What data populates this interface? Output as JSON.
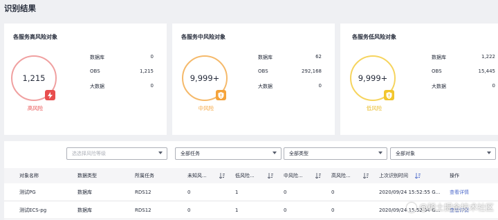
{
  "page": {
    "title": "识别结果"
  },
  "colors": {
    "high": "#e84e4e",
    "high_ring": "#f0a0a0",
    "medium": "#f5a33a",
    "medium_ring": "#f5b96a",
    "low": "#f2c62d",
    "low_ring": "#f6d45e",
    "link": "#526ecc"
  },
  "cards": [
    {
      "title": "各服务高风险对象",
      "count": "1,215",
      "level_label": "高风险",
      "badge_icon": "lightning-icon",
      "stats": [
        {
          "label": "数据库",
          "value": "0"
        },
        {
          "label": "OBS",
          "value": "1,215"
        },
        {
          "label": "大数据",
          "value": "0"
        }
      ]
    },
    {
      "title": "各服务中风险对象",
      "count": "9,999+",
      "level_label": "中风险",
      "badge_icon": "shield-icon",
      "stats": [
        {
          "label": "数据库",
          "value": "62"
        },
        {
          "label": "OBS",
          "value": "292,168"
        },
        {
          "label": "大数据",
          "value": "0"
        }
      ]
    },
    {
      "title": "各服务低风险对象",
      "count": "9,999+",
      "level_label": "低风险",
      "badge_icon": "shield-icon",
      "stats": [
        {
          "label": "数据库",
          "value": "1,222"
        },
        {
          "label": "OBS",
          "value": "15,445"
        },
        {
          "label": "大数据",
          "value": "0"
        }
      ]
    }
  ],
  "filters": {
    "risk_level": {
      "placeholder": "选选择风险等级"
    },
    "task": {
      "value": "全部任务"
    },
    "type": {
      "value": "全部类型"
    },
    "object": {
      "value": "全部对象"
    }
  },
  "table": {
    "columns": [
      "对象名称",
      "数据类型",
      "所属任务",
      "未知风...",
      "低风险...",
      "中风险...",
      "高风险...",
      "上次识别时间",
      "操作"
    ],
    "rows": [
      {
        "name": "测试PG",
        "data_type": "数据库",
        "task": "RDS12",
        "unknown": "0",
        "low": "1",
        "medium": "0",
        "high": "0",
        "last_time": "2020/09/24 15:52:55 G...",
        "action": "查看详情"
      },
      {
        "name": "测试ECS-pg",
        "data_type": "数据库",
        "task": "RDS12",
        "unknown": "0",
        "low": "1",
        "medium": "0",
        "high": "0",
        "last_time": "2020/09/24 15:52:54 G...",
        "action": "查看详情"
      }
    ]
  },
  "watermark": {
    "text": "@稀土掘金技术社区",
    "icon": "juejin-logo-icon"
  }
}
